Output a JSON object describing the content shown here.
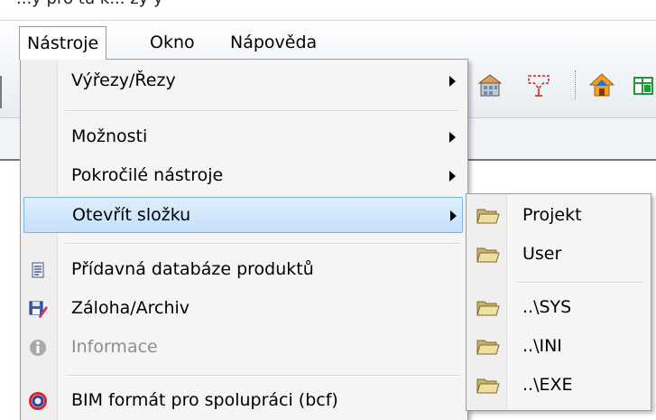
{
  "window_title_fragment": "...y pro tu k... zy y",
  "menubar": {
    "items": [
      {
        "label": "Nástroje"
      },
      {
        "label": "Okno"
      },
      {
        "label": "Nápověda"
      }
    ]
  },
  "nastroje_menu": {
    "items": [
      {
        "label": "Výřezy/Řezy",
        "submenu": true
      },
      {
        "label": "Možnosti",
        "submenu": true
      },
      {
        "label": "Pokročilé nástroje",
        "submenu": true
      },
      {
        "label": "Otevřít složku",
        "submenu": true,
        "highlighted": true
      },
      {
        "label": "Přídavná databáze produktů",
        "icon": "database-icon"
      },
      {
        "label": "Záloha/Archiv",
        "icon": "backup-archive-icon"
      },
      {
        "label": "Informace",
        "icon": "info-icon",
        "disabled": true
      },
      {
        "label": "BIM formát pro spolupráci (bcf)",
        "icon": "bcf-logo-icon"
      }
    ]
  },
  "otevrit_slozku_submenu": {
    "items": [
      {
        "label": "Projekt",
        "icon": "folder-icon"
      },
      {
        "label": "User",
        "icon": "folder-icon"
      },
      {
        "label": "..\\SYS",
        "icon": "folder-icon"
      },
      {
        "label": "..\\INI",
        "icon": "folder-icon"
      },
      {
        "label": "..\\EXE",
        "icon": "folder-icon"
      }
    ]
  },
  "toolbar_icons": [
    "building-icon",
    "red-bracket-icon",
    "house-up-icon",
    "green-grid-icon"
  ],
  "colors": {
    "highlight_fill": "#c4e0fb",
    "highlight_border": "#7eb4ea",
    "disabled_text": "#8d8d8d",
    "menu_bg": "#f5f5f5"
  }
}
